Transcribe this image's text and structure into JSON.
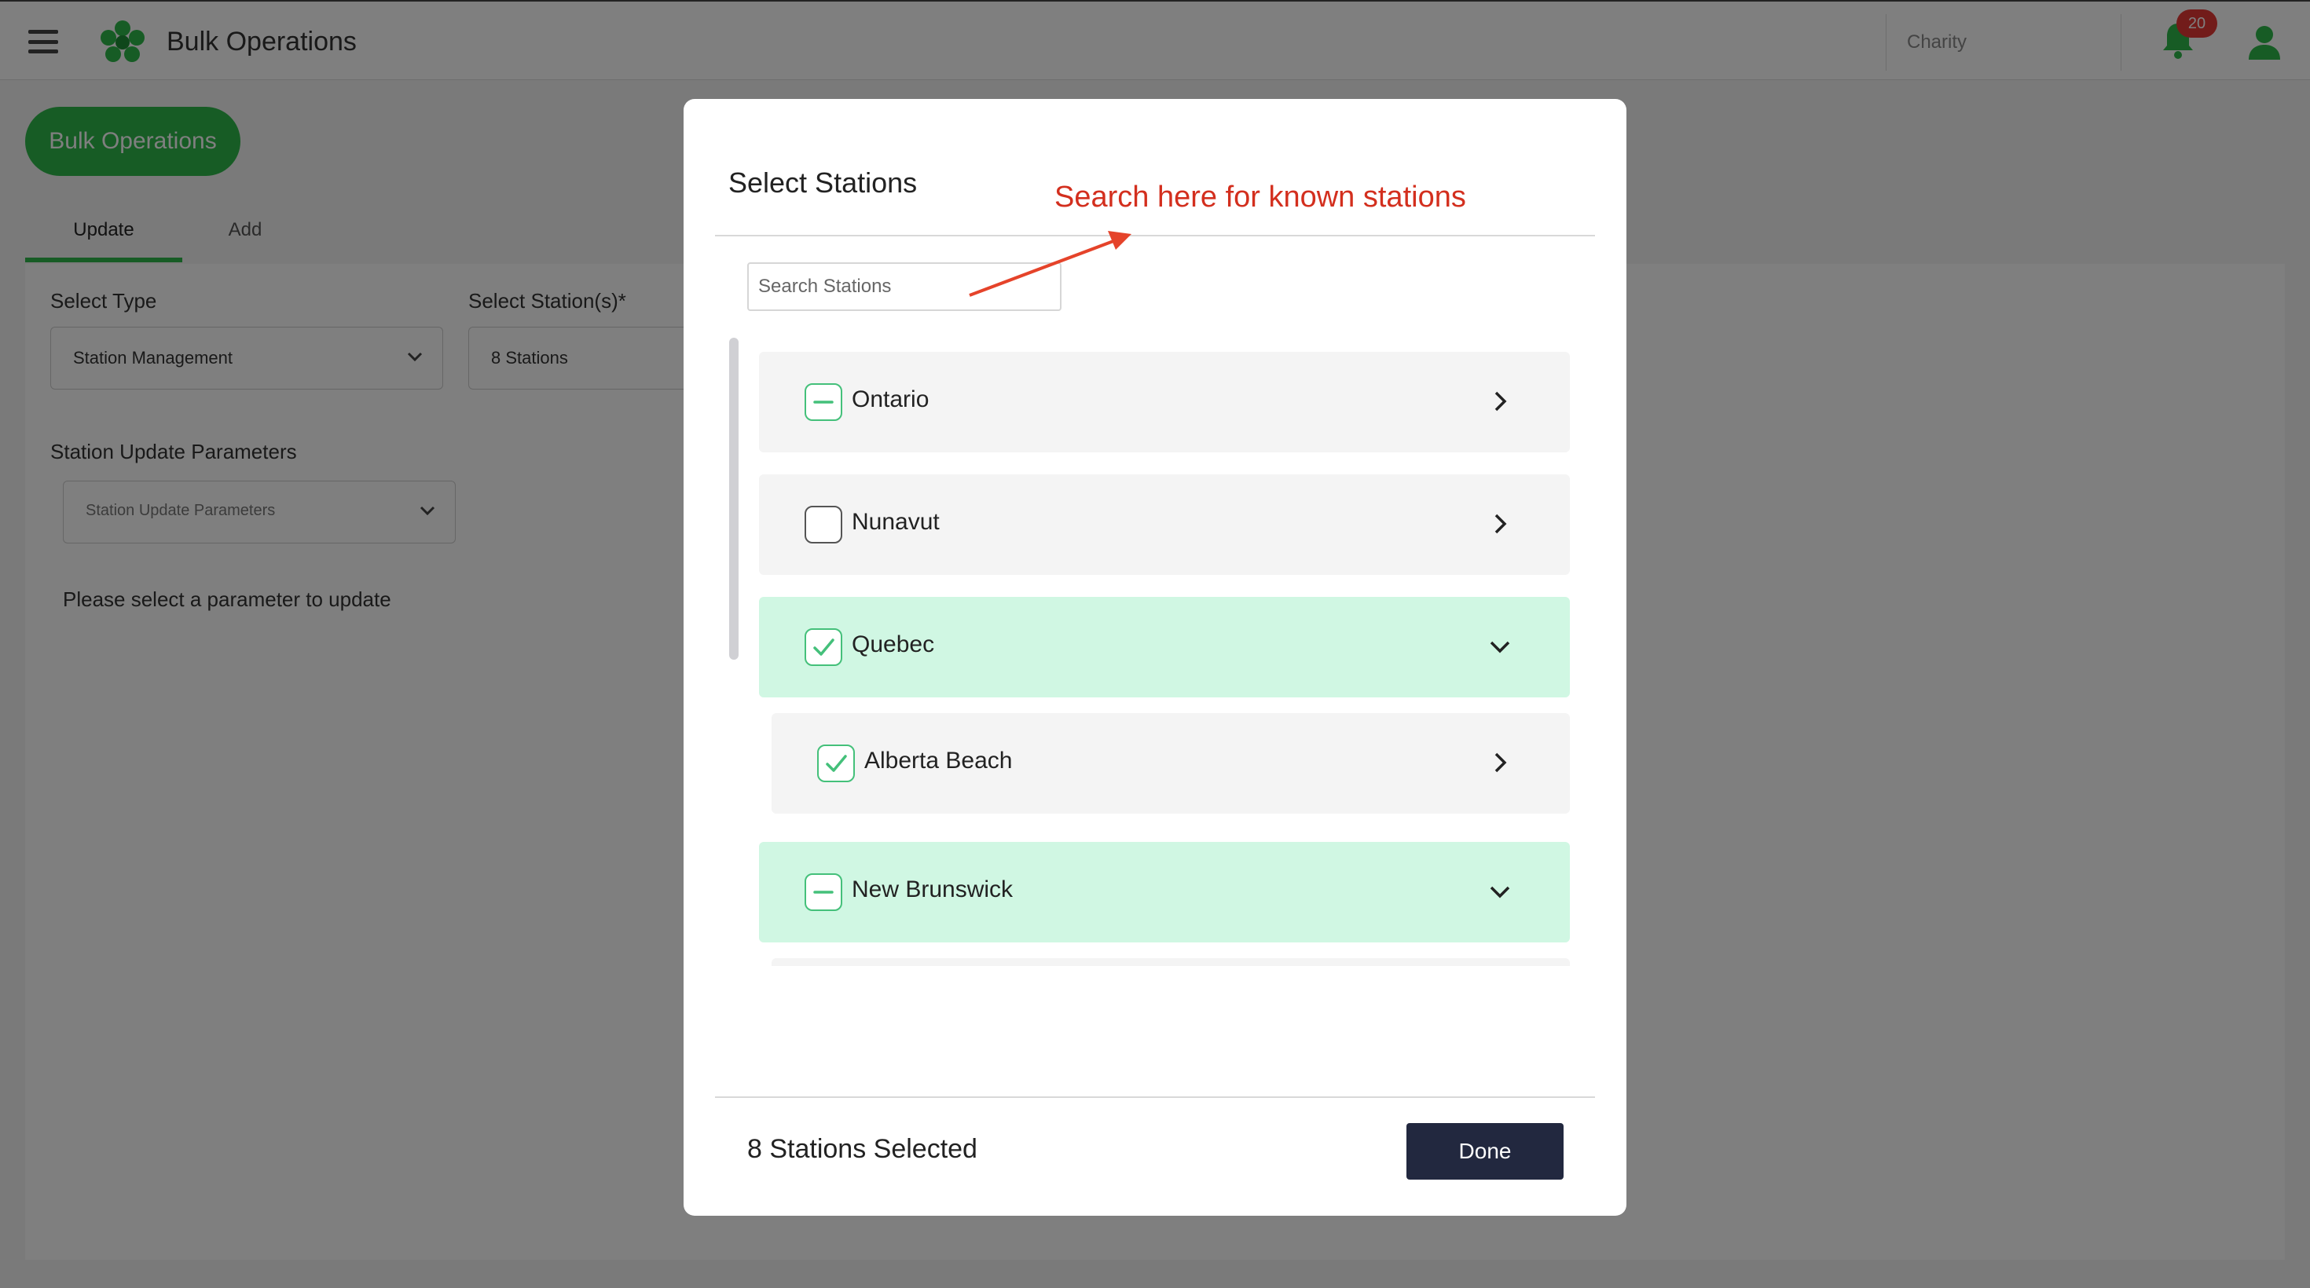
{
  "app": {
    "title": "Bulk Operations",
    "charity_placeholder": "Charity",
    "notification_count": "20",
    "bulk_button_label": "Bulk Operations",
    "tabs": [
      {
        "label": "Update",
        "active": true
      },
      {
        "label": "Add",
        "active": false
      }
    ],
    "select_type": {
      "label": "Select Type",
      "value": "Station Management"
    },
    "select_stations": {
      "label": "Select Station(s)*",
      "value": "8 Stations"
    },
    "update_params": {
      "label": "Station Update Parameters",
      "placeholder": "Station Update Parameters"
    },
    "hint": "Please select a parameter to update"
  },
  "modal": {
    "title": "Select Stations",
    "annotation": "Search here for known stations",
    "search_placeholder": "Search Stations",
    "rows": [
      {
        "label": "Ontario",
        "state": "partial",
        "expanded": false,
        "level": 0
      },
      {
        "label": "Nunavut",
        "state": "unchecked",
        "expanded": false,
        "level": 0
      },
      {
        "label": "Quebec",
        "state": "checked",
        "expanded": true,
        "level": 0
      },
      {
        "label": "Alberta Beach",
        "state": "checked",
        "expanded": false,
        "level": 1
      },
      {
        "label": "New Brunswick",
        "state": "partial",
        "expanded": true,
        "level": 0
      }
    ],
    "selected_count_text": "8 Stations Selected",
    "done_label": "Done"
  },
  "colors": {
    "accent_green": "#2eb84a",
    "check_green": "#44c07a",
    "selected_row": "#d0f7e3",
    "annotation_red": "#d32f1e",
    "done_button": "#22283f"
  }
}
